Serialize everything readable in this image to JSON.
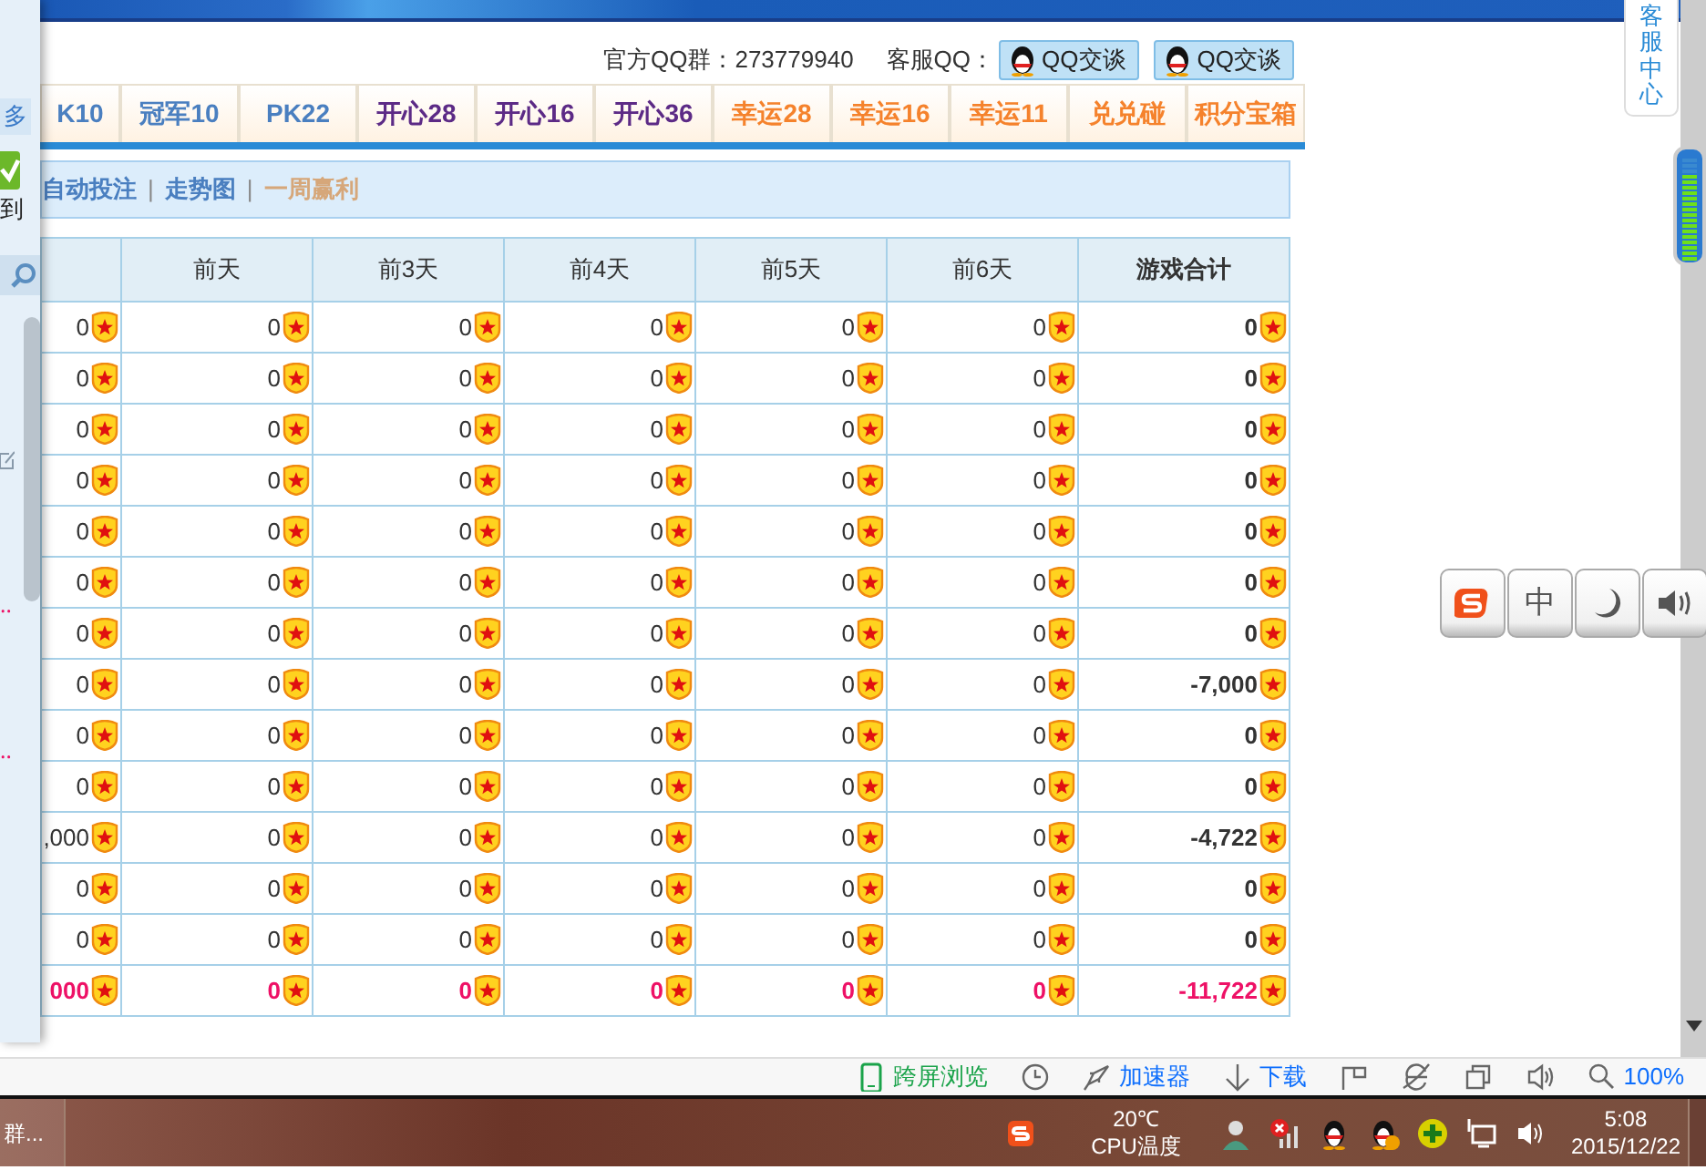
{
  "left_panel": {
    "more_link": "多",
    "sign_label": "到",
    "dots": [
      "‥",
      "‥"
    ]
  },
  "qq_bar": {
    "group_label": "官方QQ群：273779940",
    "service_label": "客服QQ：",
    "buttons": [
      "QQ交谈",
      "QQ交谈"
    ]
  },
  "tabs": [
    {
      "label": "K10",
      "color": "#4a7fc0"
    },
    {
      "label": "冠军10",
      "color": "#4a7fc0"
    },
    {
      "label": "PK22",
      "color": "#4a7fc0"
    },
    {
      "label": "开心28",
      "color": "#5c2a86"
    },
    {
      "label": "开心16",
      "color": "#5c2a86"
    },
    {
      "label": "开心36",
      "color": "#5c2a86"
    },
    {
      "label": "幸运28",
      "color": "#f5822c"
    },
    {
      "label": "幸运16",
      "color": "#f5822c"
    },
    {
      "label": "幸运11",
      "color": "#f5822c"
    },
    {
      "label": "兑兑碰",
      "color": "#f5822c"
    },
    {
      "label": "积分宝箱",
      "color": "#f5822c"
    }
  ],
  "subnav_separators": [
    "|",
    "|"
  ],
  "subnav": [
    {
      "label": "自动投注",
      "selected": false
    },
    {
      "label": "走势图",
      "selected": false
    },
    {
      "label": "一周赢利",
      "selected": true
    }
  ],
  "table": {
    "columns": [
      "",
      "前天",
      "前3天",
      "前4天",
      "前5天",
      "前6天",
      "游戏合计"
    ],
    "rows": [
      {
        "kind": "data",
        "cells": [
          "0",
          "0",
          "0",
          "0",
          "0",
          "0",
          "0"
        ]
      },
      {
        "kind": "data",
        "cells": [
          "0",
          "0",
          "0",
          "0",
          "0",
          "0",
          "0"
        ]
      },
      {
        "kind": "data",
        "cells": [
          "0",
          "0",
          "0",
          "0",
          "0",
          "0",
          "0"
        ]
      },
      {
        "kind": "data",
        "cells": [
          "0",
          "0",
          "0",
          "0",
          "0",
          "0",
          "0"
        ]
      },
      {
        "kind": "data",
        "cells": [
          "0",
          "0",
          "0",
          "0",
          "0",
          "0",
          "0"
        ]
      },
      {
        "kind": "data",
        "cells": [
          "0",
          "0",
          "0",
          "0",
          "0",
          "0",
          "0"
        ]
      },
      {
        "kind": "data",
        "cells": [
          "0",
          "0",
          "0",
          "0",
          "0",
          "0",
          "0"
        ]
      },
      {
        "kind": "data",
        "cells": [
          "0",
          "0",
          "0",
          "0",
          "0",
          "0",
          "-7,000"
        ]
      },
      {
        "kind": "data",
        "cells": [
          "0",
          "0",
          "0",
          "0",
          "0",
          "0",
          "0"
        ]
      },
      {
        "kind": "data",
        "cells": [
          "0",
          "0",
          "0",
          "0",
          "0",
          "0",
          "0"
        ]
      },
      {
        "kind": "data",
        "cells": [
          ",000",
          "0",
          "0",
          "0",
          "0",
          "0",
          "-4,722"
        ]
      },
      {
        "kind": "data",
        "cells": [
          "0",
          "0",
          "0",
          "0",
          "0",
          "0",
          "0"
        ]
      },
      {
        "kind": "data",
        "cells": [
          "0",
          "0",
          "0",
          "0",
          "0",
          "0",
          "0"
        ]
      },
      {
        "kind": "total",
        "cells": [
          "000",
          "0",
          "0",
          "0",
          "0",
          "0",
          "-11,722"
        ]
      }
    ]
  },
  "service_tab": "客服中心",
  "ime_toolbar": [
    {
      "kind": "logo"
    },
    {
      "kind": "text",
      "label": "中"
    },
    {
      "kind": "moon"
    },
    {
      "kind": "speaker"
    }
  ],
  "status_bar": [
    {
      "kind": "phone",
      "label": "跨屏浏览"
    },
    {
      "kind": "clock"
    },
    {
      "kind": "rocket",
      "label": "加速器"
    },
    {
      "kind": "download",
      "label": "下载"
    },
    {
      "kind": "flag"
    },
    {
      "kind": "ie"
    },
    {
      "kind": "window"
    },
    {
      "kind": "sound"
    },
    {
      "kind": "zoom",
      "label": "100%"
    }
  ],
  "taskbar": {
    "task": "群...",
    "temperature": "20℃",
    "temperature_label": "CPU温度",
    "time": "5:08",
    "date": "2015/12/22"
  }
}
